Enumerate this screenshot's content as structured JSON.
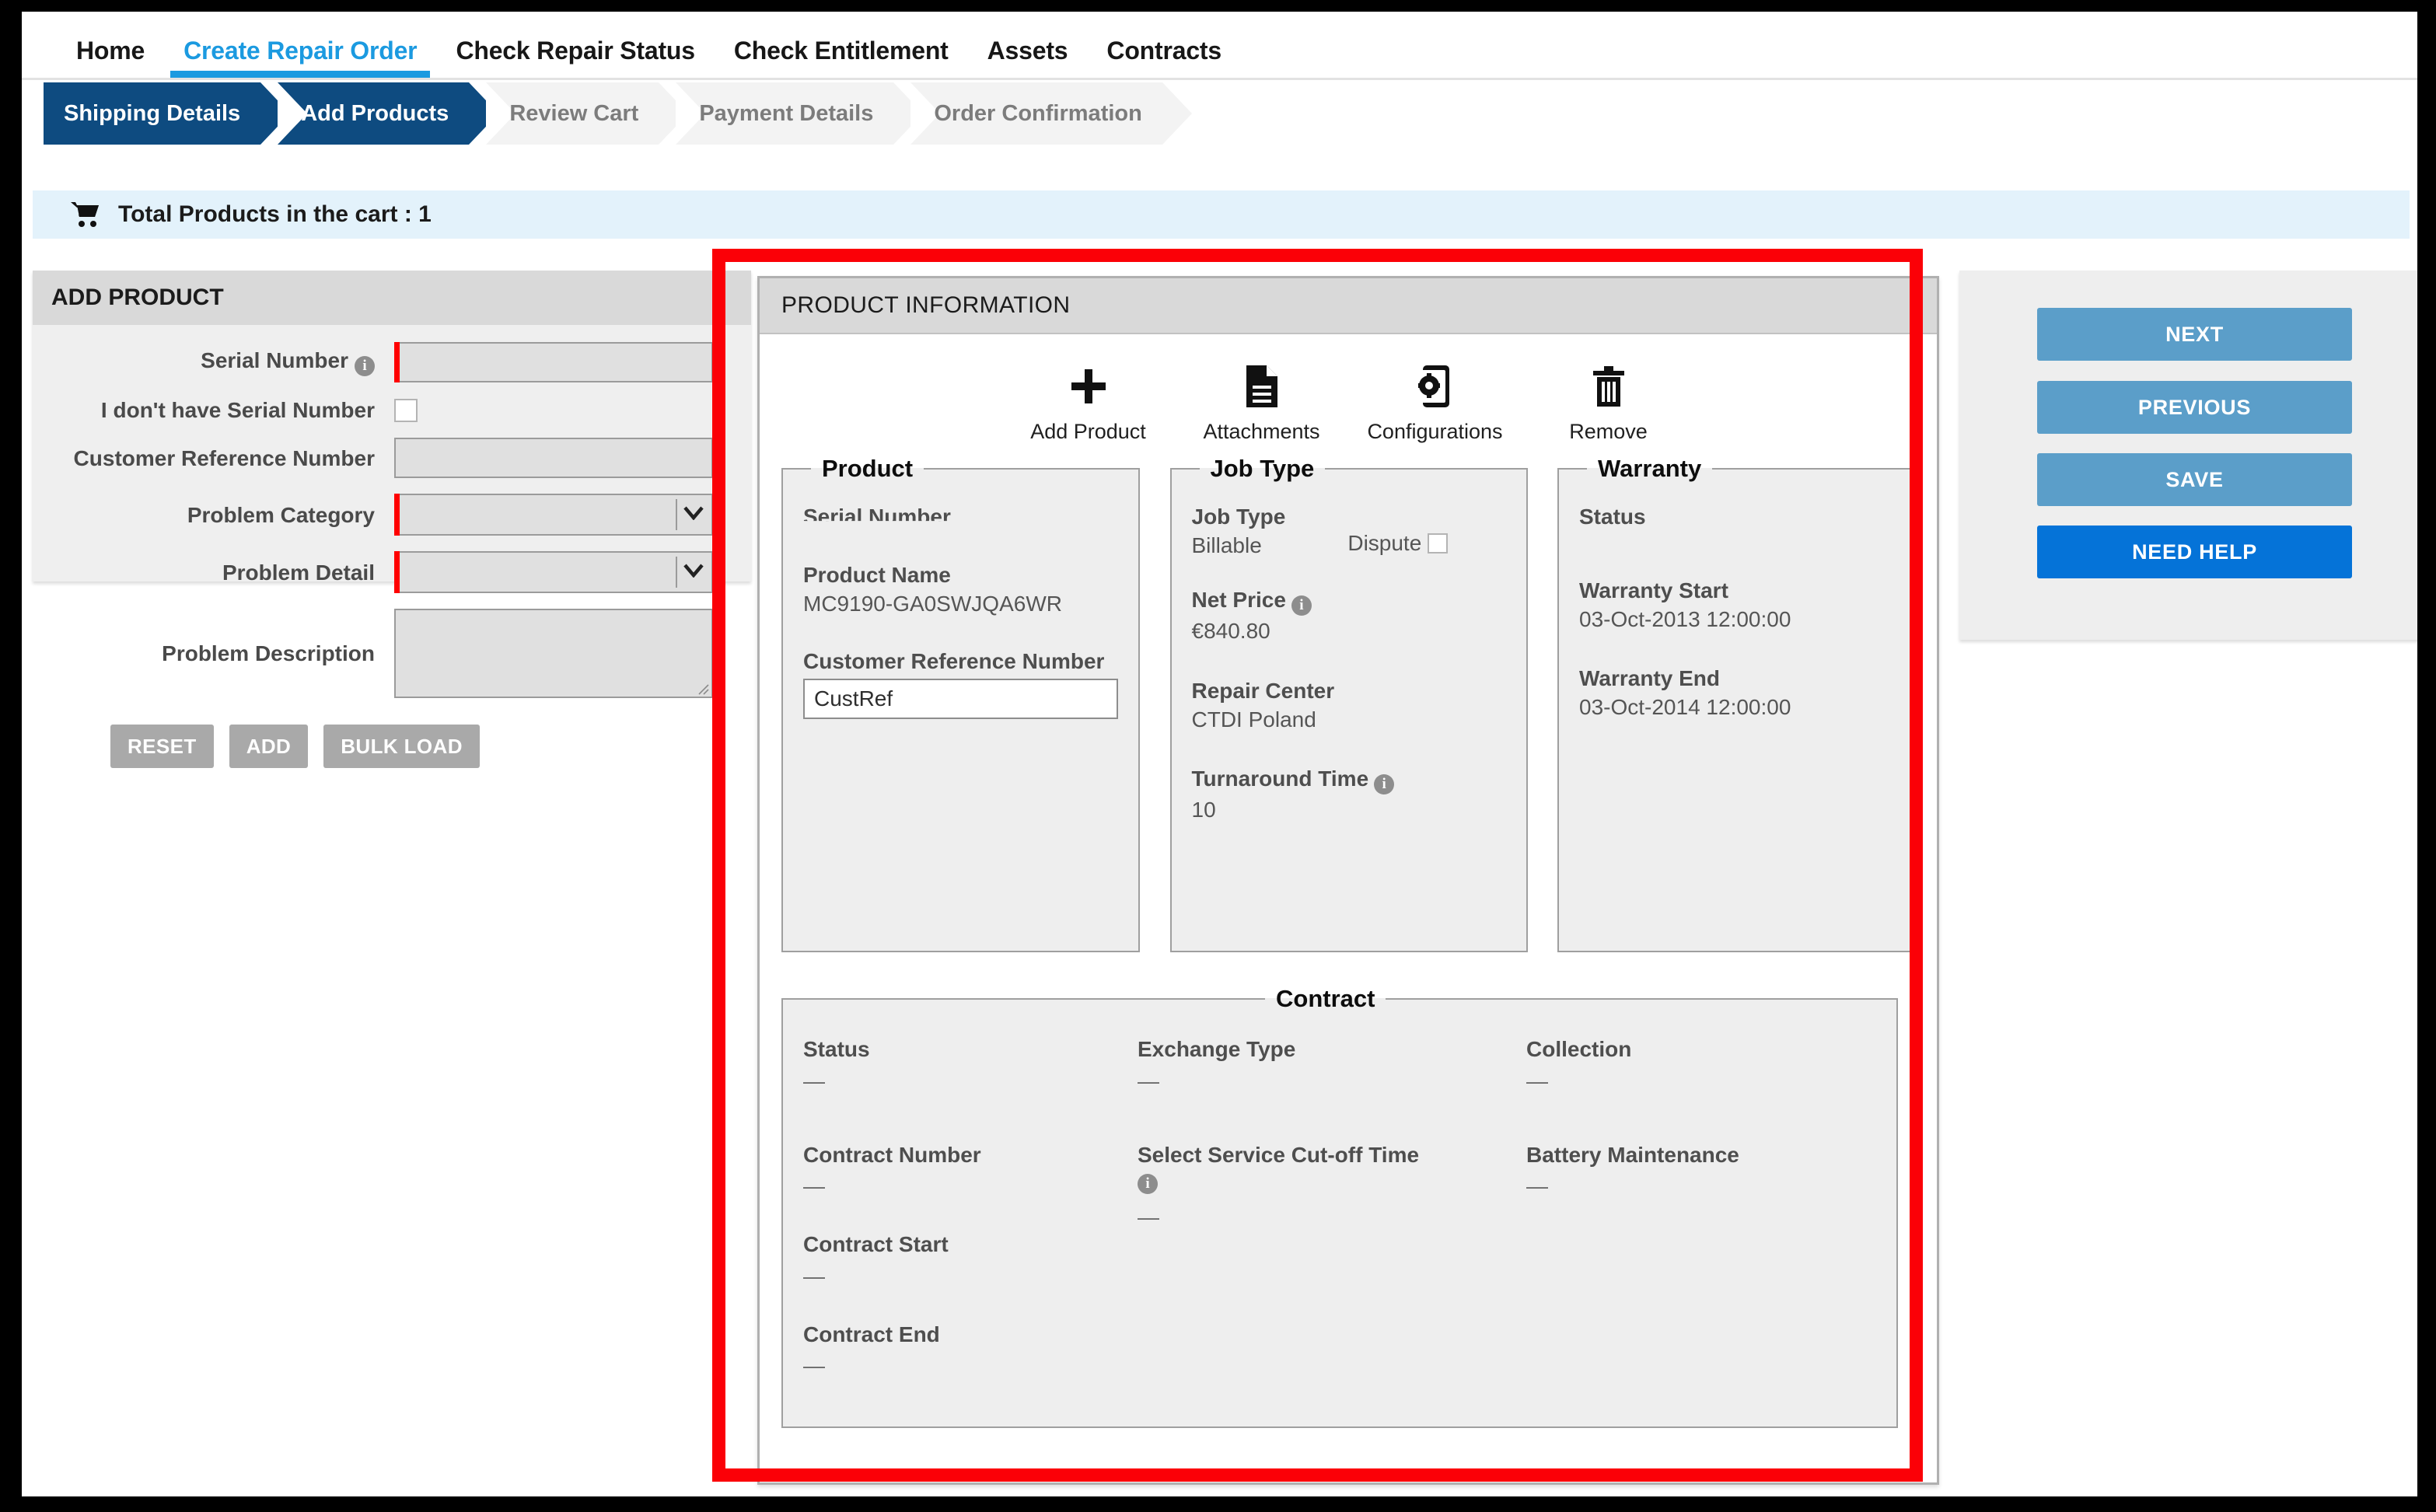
{
  "nav": {
    "items": [
      {
        "label": "Home",
        "active": false
      },
      {
        "label": "Create Repair Order",
        "active": true
      },
      {
        "label": "Check Repair Status",
        "active": false
      },
      {
        "label": "Check Entitlement",
        "active": false
      },
      {
        "label": "Assets",
        "active": false
      },
      {
        "label": "Contracts",
        "active": false
      }
    ],
    "active_color": "#1b9ae0"
  },
  "wizard": {
    "steps": [
      {
        "label": "Shipping Details",
        "state": "done"
      },
      {
        "label": "Add Products",
        "state": "current"
      },
      {
        "label": "Review Cart",
        "state": "todo"
      },
      {
        "label": "Payment Details",
        "state": "todo"
      },
      {
        "label": "Order Confirmation",
        "state": "todo"
      }
    ],
    "active_color": "#0e4b80",
    "inactive_color": "#f3f3f3"
  },
  "cart_bar": {
    "icon": "shopping-cart-icon",
    "text": "Total Products in the cart : 1"
  },
  "add_product": {
    "title": "ADD PRODUCT",
    "fields": {
      "serial_number_label": "Serial Number",
      "serial_number_value": "",
      "no_serial_label": "I don't have Serial Number",
      "no_serial_checked": false,
      "customer_ref_label": "Customer Reference Number",
      "customer_ref_value": "",
      "problem_category_label": "Problem Category",
      "problem_category_value": "",
      "problem_detail_label": "Problem Detail",
      "problem_detail_value": "",
      "problem_description_label": "Problem Description",
      "problem_description_value": ""
    },
    "buttons": {
      "reset": "RESET",
      "add": "ADD",
      "bulk_load": "BULK LOAD"
    }
  },
  "actions": {
    "next": "NEXT",
    "previous": "PREVIOUS",
    "save": "SAVE",
    "need_help": "NEED HELP",
    "light_color": "#5b9ec9",
    "help_color": "#0573d8"
  },
  "product_information": {
    "title": "PRODUCT INFORMATION",
    "toolbar": [
      {
        "label": "Add Product",
        "icon": "plus-icon"
      },
      {
        "label": "Attachments",
        "icon": "document-icon"
      },
      {
        "label": "Configurations",
        "icon": "device-gear-icon"
      },
      {
        "label": "Remove",
        "icon": "trash-icon"
      }
    ],
    "product": {
      "legend": "Product",
      "serial_number_label": "Serial Number",
      "serial_number_value": "",
      "product_name_label": "Product Name",
      "product_name_value": "MC9190-GA0SWJQA6WR",
      "customer_ref_label": "Customer Reference Number",
      "customer_ref_value": "CustRef"
    },
    "job_type": {
      "legend": "Job Type",
      "job_type_label": "Job Type",
      "job_type_value": "Billable",
      "dispute_label": "Dispute",
      "dispute_checked": false,
      "net_price_label": "Net Price",
      "net_price_value": "€840.80",
      "repair_center_label": "Repair Center",
      "repair_center_value": "CTDI Poland",
      "turnaround_time_label": "Turnaround Time",
      "turnaround_time_value": "10"
    },
    "warranty": {
      "legend": "Warranty",
      "status_label": "Status",
      "status_value": "",
      "warranty_start_label": "Warranty Start",
      "warranty_start_value": "03-Oct-2013 12:00:00",
      "warranty_end_label": "Warranty End",
      "warranty_end_value": "03-Oct-2014 12:00:00"
    },
    "contract": {
      "legend": "Contract",
      "col1": [
        {
          "label": "Status",
          "value": "—"
        },
        {
          "label": "Contract Number",
          "value": "—"
        },
        {
          "label": "Contract Start",
          "value": "—"
        },
        {
          "label": "Contract End",
          "value": "—"
        }
      ],
      "col2": [
        {
          "label": "Exchange Type",
          "value": "—"
        },
        {
          "label": "Select Service Cut-off Time",
          "value": "—",
          "info": true
        }
      ],
      "col3": [
        {
          "label": "Collection",
          "value": "—"
        },
        {
          "label": "Battery Maintenance",
          "value": "—"
        }
      ]
    }
  },
  "highlight": {
    "color": "#fb0007"
  }
}
